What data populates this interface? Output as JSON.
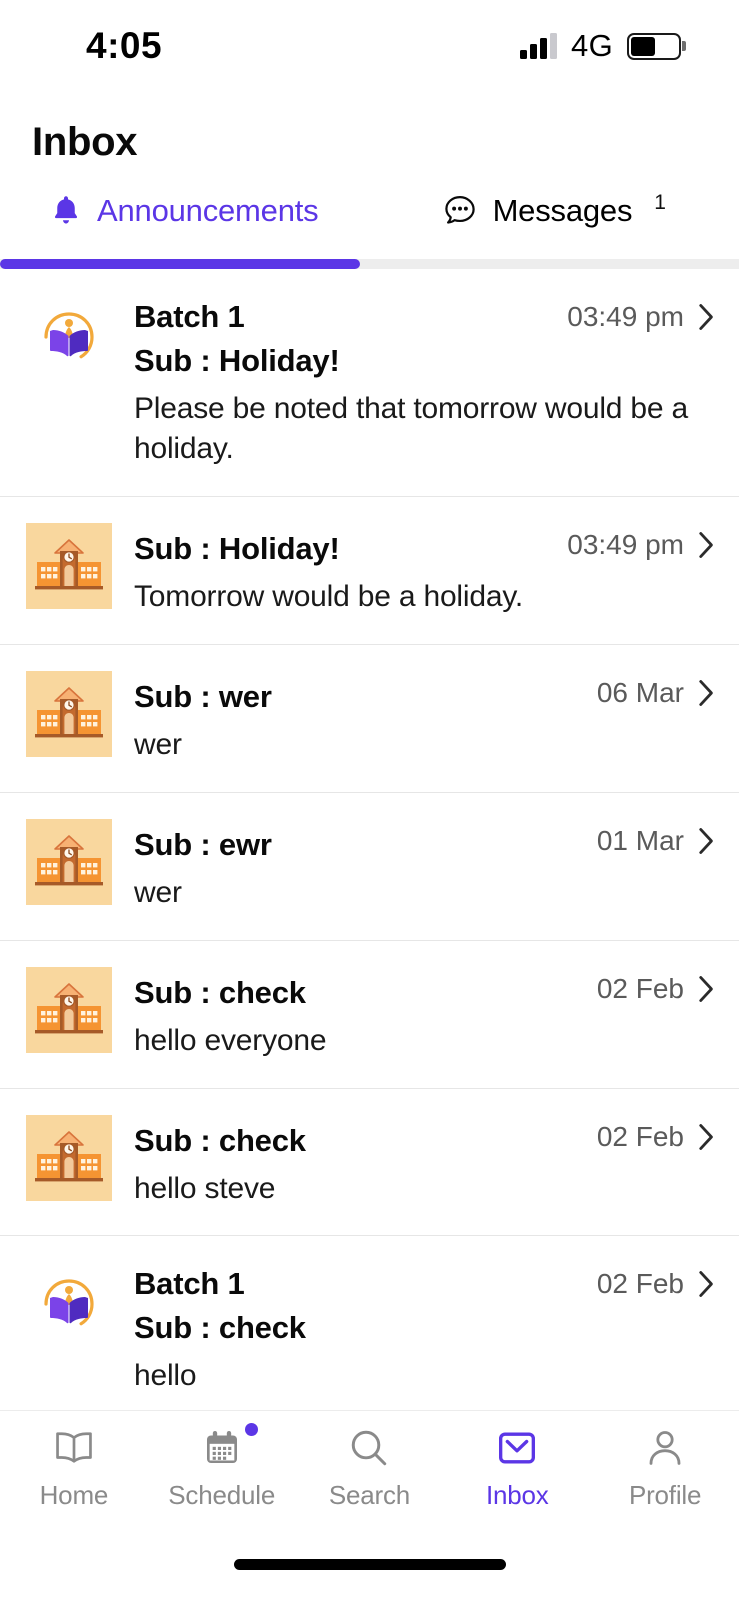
{
  "status_bar": {
    "time": "4:05",
    "network": "4G",
    "signal_bars_filled": 3,
    "signal_bars_total": 4,
    "battery_percent": 52
  },
  "header": {
    "title": "Inbox"
  },
  "tabs": [
    {
      "label": "Announcements",
      "icon": "bell-icon",
      "active": true,
      "badge": ""
    },
    {
      "label": "Messages",
      "icon": "chat-bubble-icon",
      "active": false,
      "badge": "1"
    }
  ],
  "colors": {
    "accent": "#5B36E6",
    "avatar_bg": "#F9D79E",
    "text_primary": "#0A0A0A",
    "text_muted": "#5A5A5A",
    "separator": "#E6E6E6"
  },
  "announcements": [
    {
      "avatar": "institute-logo-icon",
      "batch": "Batch 1",
      "subject": "Sub : Holiday!",
      "preview": "Please be noted that tomorrow would be a holiday.",
      "time": "03:49 pm"
    },
    {
      "avatar": "school-building-icon",
      "batch": "",
      "subject": "Sub : Holiday!",
      "preview": "Tomorrow would be a holiday.",
      "time": "03:49 pm"
    },
    {
      "avatar": "school-building-icon",
      "batch": "",
      "subject": "Sub : wer",
      "preview": "wer",
      "time": "06 Mar"
    },
    {
      "avatar": "school-building-icon",
      "batch": "",
      "subject": "Sub : ewr",
      "preview": "wer",
      "time": "01 Mar"
    },
    {
      "avatar": "school-building-icon",
      "batch": "",
      "subject": "Sub : check",
      "preview": "hello everyone",
      "time": "02 Feb"
    },
    {
      "avatar": "school-building-icon",
      "batch": "",
      "subject": "Sub : check",
      "preview": "hello steve",
      "time": "02 Feb"
    },
    {
      "avatar": "institute-logo-icon",
      "batch": "Batch 1",
      "subject": "Sub : check",
      "preview": "hello",
      "time": "02 Feb"
    }
  ],
  "bottom_nav": [
    {
      "label": "Home",
      "icon": "book-icon",
      "active": false,
      "dot": false
    },
    {
      "label": "Schedule",
      "icon": "calendar-icon",
      "active": false,
      "dot": true
    },
    {
      "label": "Search",
      "icon": "search-icon",
      "active": false,
      "dot": false
    },
    {
      "label": "Inbox",
      "icon": "envelope-icon",
      "active": true,
      "dot": false
    },
    {
      "label": "Profile",
      "icon": "person-icon",
      "active": false,
      "dot": false
    }
  ]
}
